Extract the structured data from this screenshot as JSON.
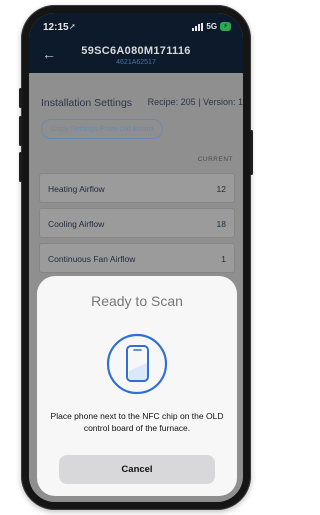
{
  "status_bar": {
    "time": "12:15",
    "network": "5G"
  },
  "header": {
    "serial": "59SC6A080M171116",
    "subserial": "4621A62517"
  },
  "settings": {
    "title": "Installation Settings",
    "recipe_info": "Recipe: 205  |  Version: 1",
    "copy_button": "Copy Settings From Old Board",
    "column_header": "CURRENT",
    "rows": [
      {
        "label": "Heating Airflow",
        "value": "12"
      },
      {
        "label": "Cooling Airflow",
        "value": "18"
      },
      {
        "label": "Continuous Fan Airflow",
        "value": "1"
      }
    ]
  },
  "nfc_sheet": {
    "title": "Ready to Scan",
    "instruction": "Place phone next to the NFC chip on the OLD control board of the furnace.",
    "cancel_label": "Cancel",
    "accent_color": "#2f6fd6"
  }
}
